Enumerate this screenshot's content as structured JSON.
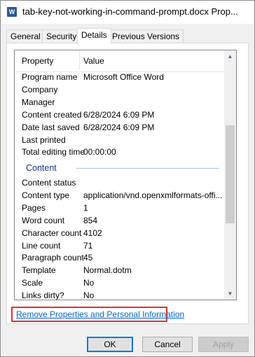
{
  "window": {
    "title": "tab-key-not-working-in-command-prompt.docx Prop...",
    "icon": "word-document-icon"
  },
  "tabs": [
    {
      "label": "General"
    },
    {
      "label": "Security"
    },
    {
      "label": "Details",
      "active": true
    },
    {
      "label": "Previous Versions"
    }
  ],
  "columns": {
    "property": "Property",
    "value": "Value"
  },
  "rows_top": [
    {
      "k": "Program name",
      "v": "Microsoft Office Word"
    },
    {
      "k": "Company",
      "v": ""
    },
    {
      "k": "Manager",
      "v": ""
    },
    {
      "k": "Content created",
      "v": "6/28/2024 6:09 PM"
    },
    {
      "k": "Date last saved",
      "v": "6/28/2024 6:09 PM"
    },
    {
      "k": "Last printed",
      "v": ""
    },
    {
      "k": "Total editing time",
      "v": "00:00:00"
    }
  ],
  "group": {
    "label": "Content"
  },
  "rows_bottom": [
    {
      "k": "Content status",
      "v": ""
    },
    {
      "k": "Content type",
      "v": "application/vnd.openxmlformats-offi..."
    },
    {
      "k": "Pages",
      "v": "1"
    },
    {
      "k": "Word count",
      "v": "854"
    },
    {
      "k": "Character count",
      "v": "4102"
    },
    {
      "k": "Line count",
      "v": "71"
    },
    {
      "k": "Paragraph count",
      "v": "45"
    },
    {
      "k": "Template",
      "v": "Normal.dotm"
    },
    {
      "k": "Scale",
      "v": "No"
    },
    {
      "k": "Links dirty?",
      "v": "No"
    }
  ],
  "link": "Remove Properties and Personal Information",
  "buttons": {
    "ok": "OK",
    "cancel": "Cancel",
    "apply": "Apply"
  },
  "colors": {
    "highlight_box": "#e32e2e",
    "link": "#0066cc",
    "group": "#1e3287"
  }
}
